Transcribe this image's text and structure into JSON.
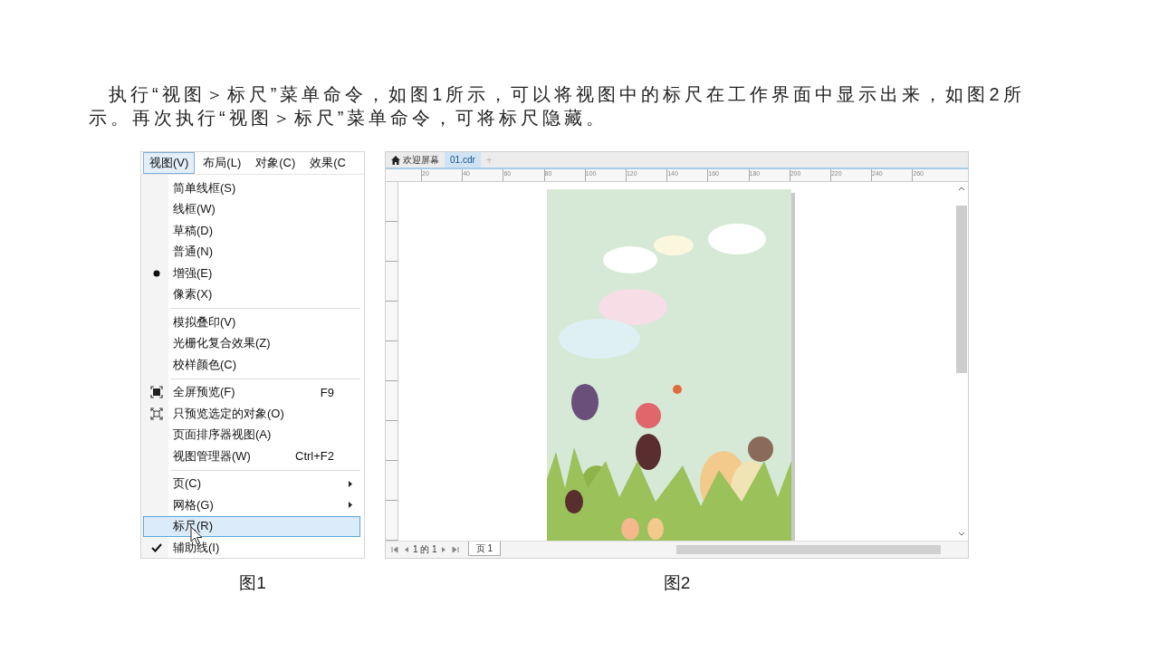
{
  "paragraph": "执行“视图＞标尺”菜单命令，如图1所示，可以将视图中的标尺在工作界面中显示出来，如图2所示。再次执行“视图＞标尺”菜单命令，可将标尺隐藏。",
  "figure_1": {
    "menubar": [
      {
        "label": "视图(V)",
        "selected": true
      },
      {
        "label": "布局(L)",
        "selected": false
      },
      {
        "label": "对象(C)",
        "selected": false
      },
      {
        "label": "效果(C",
        "selected": false
      }
    ],
    "menu_groups": [
      [
        {
          "label": "简单线框(S)",
          "kind": "plain",
          "submenu": false,
          "selected": false
        },
        {
          "label": "线框(W)",
          "kind": "plain",
          "submenu": false,
          "selected": false
        },
        {
          "label": "草稿(D)",
          "kind": "plain",
          "submenu": false,
          "selected": false
        },
        {
          "label": "普通(N)",
          "kind": "plain",
          "submenu": false,
          "selected": false
        },
        {
          "label": "增强(E)",
          "kind": "radio",
          "submenu": false,
          "selected": false
        },
        {
          "label": "像素(X)",
          "kind": "plain",
          "submenu": false,
          "selected": false
        }
      ],
      [
        {
          "label": "模拟叠印(V)",
          "kind": "plain",
          "submenu": false,
          "selected": false
        },
        {
          "label": "光栅化复合效果(Z)",
          "kind": "plain",
          "submenu": false,
          "selected": false
        },
        {
          "label": "校样颜色(C)",
          "kind": "plain",
          "submenu": false,
          "selected": false
        }
      ],
      [
        {
          "label": "全屏预览(F)",
          "kind": "fullscreen",
          "shortcut": "F9",
          "submenu": false,
          "selected": false
        },
        {
          "label": "只预览选定的对象(O)",
          "kind": "selection",
          "submenu": false,
          "selected": false
        },
        {
          "label": "页面排序器视图(A)",
          "kind": "plain",
          "submenu": false,
          "selected": false
        },
        {
          "label": "视图管理器(W)",
          "kind": "plain",
          "shortcut": "Ctrl+F2",
          "submenu": false,
          "selected": false
        }
      ],
      [
        {
          "label": "页(C)",
          "kind": "plain",
          "submenu": true,
          "selected": false
        },
        {
          "label": "网格(G)",
          "kind": "plain",
          "submenu": true,
          "selected": false
        },
        {
          "label": "标尺(R)",
          "kind": "plain",
          "submenu": false,
          "selected": true
        },
        {
          "label": "辅助线(I)",
          "kind": "check",
          "submenu": false,
          "selected": false
        }
      ]
    ],
    "caption": "图1"
  },
  "figure_2": {
    "tabs": [
      {
        "label": "欢迎屏幕",
        "kind": "home",
        "selected": false
      },
      {
        "label": "01.cdr",
        "kind": "document",
        "selected": true
      },
      {
        "label": "+",
        "kind": "new",
        "selected": false
      }
    ],
    "ruler_labels": [
      "20",
      "40",
      "60",
      "80",
      "100",
      "120",
      "140",
      "160",
      "180",
      "200",
      "220",
      "240",
      "260"
    ],
    "page_count": "1 的 1",
    "page_tab": "页 1",
    "caption": "图2"
  }
}
